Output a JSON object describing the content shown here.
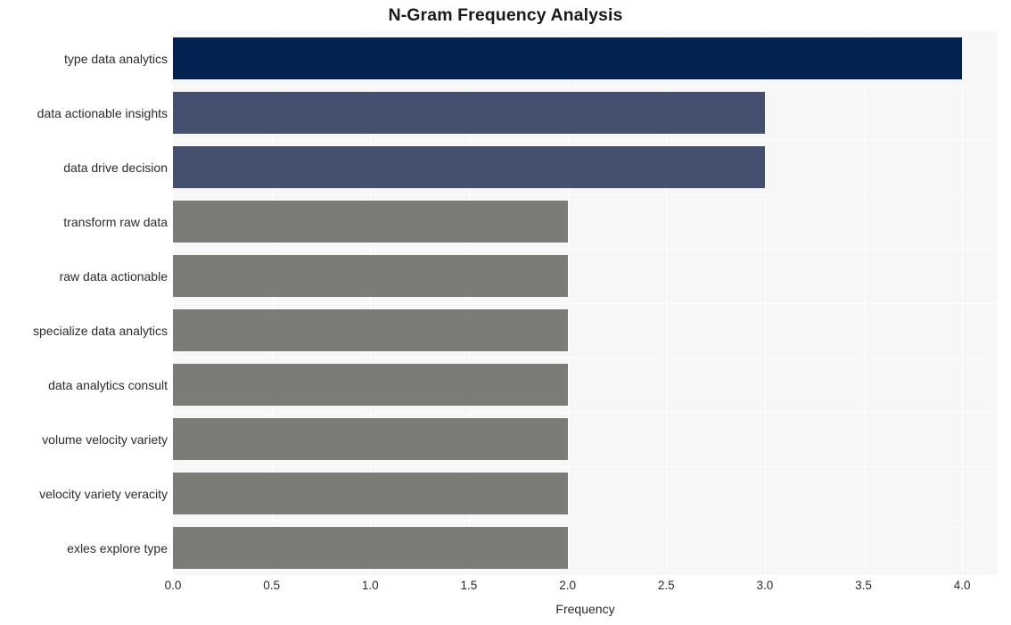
{
  "chart_data": {
    "type": "bar",
    "orientation": "horizontal",
    "title": "N-Gram Frequency Analysis",
    "xlabel": "Frequency",
    "ylabel": "",
    "categories": [
      "type data analytics",
      "data actionable insights",
      "data drive decision",
      "transform raw data",
      "raw data actionable",
      "specialize data analytics",
      "data analytics consult",
      "volume velocity variety",
      "velocity variety veracity",
      "exles explore type"
    ],
    "values": [
      4,
      3,
      3,
      2,
      2,
      2,
      2,
      2,
      2,
      2
    ],
    "bar_colors": [
      "#022350",
      "#454f70",
      "#454f70",
      "#7b7b78",
      "#7b7b78",
      "#7b7b78",
      "#7b7b78",
      "#7b7b78",
      "#7b7b78",
      "#7b7b78"
    ],
    "xlim": [
      0,
      4.18
    ],
    "xticks": [
      0.0,
      0.5,
      1.0,
      1.5,
      2.0,
      2.5,
      3.0,
      3.5,
      4.0
    ],
    "xtick_labels": [
      "0.0",
      "0.5",
      "1.0",
      "1.5",
      "2.0",
      "2.5",
      "3.0",
      "3.5",
      "4.0"
    ],
    "grid": true,
    "legend": false,
    "plot_background": "#f7f7f7",
    "figure_background": "#ffffff",
    "gridline_color": "#ffffff",
    "title_color": "#1a1a1a",
    "tick_label_color": "#2b2b2b"
  }
}
